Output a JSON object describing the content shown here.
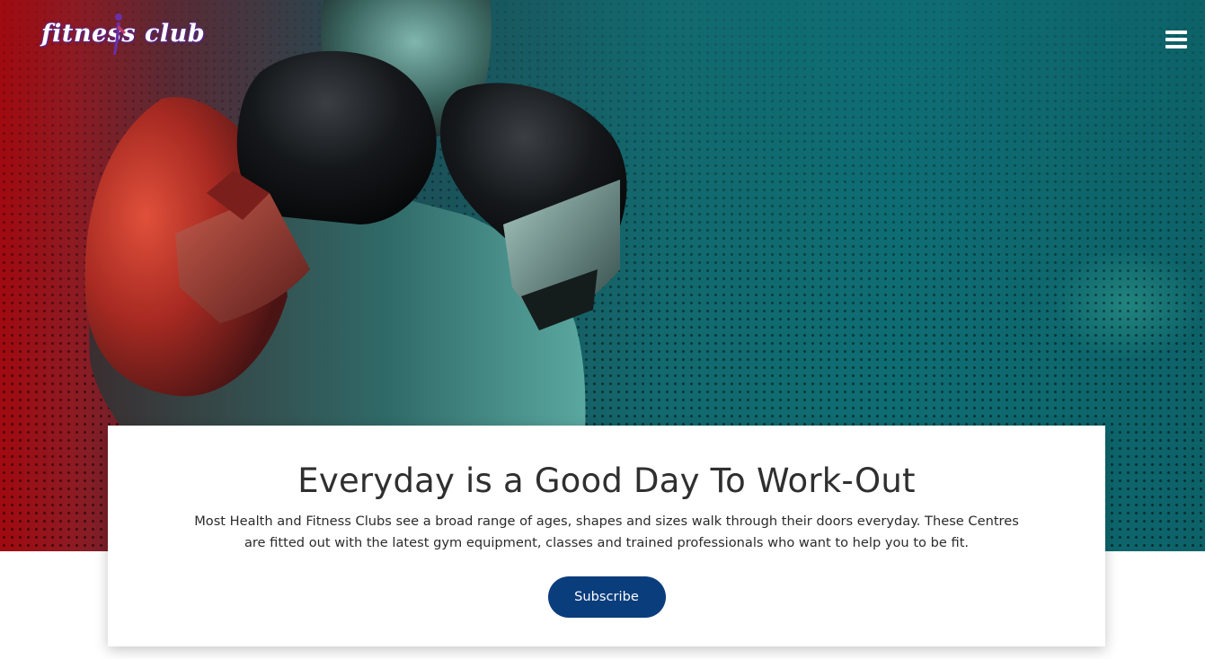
{
  "header": {
    "logo_text": "fitness club",
    "menu_icon": "hamburger-menu-icon"
  },
  "hero": {
    "image_subject": "boxer-with-gloves",
    "colors": {
      "left": "#a00a10",
      "right": "#0e6d73"
    }
  },
  "card": {
    "title": "Everyday is a Good Day To Work-Out",
    "description": "Most Health and Fitness Clubs see a broad range of ages, shapes and sizes walk through their doors everyday. These Centres are fitted out with the latest gym equipment, classes and trained professionals who want to help you to be fit.",
    "button_label": "Subscribe",
    "button_color": "#0a3d7c"
  }
}
